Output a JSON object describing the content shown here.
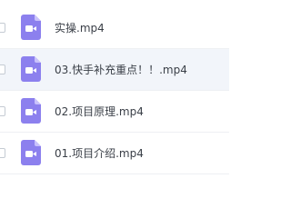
{
  "files": [
    {
      "name": "实操.mp4",
      "icon": "video-file-icon",
      "selected": false
    },
    {
      "name": "03.快手补充重点！！.mp4",
      "icon": "video-file-icon",
      "selected": true
    },
    {
      "name": "02.项目原理.mp4",
      "icon": "video-file-icon",
      "selected": false
    },
    {
      "name": "01.项目介绍.mp4",
      "icon": "video-file-icon",
      "selected": false
    }
  ],
  "colors": {
    "icon_purple": "#8c80ee",
    "icon_fold": "#c9c2fb",
    "text": "#3a3f47",
    "selected_row": "#f2f5fa",
    "divider": "#eef0f3"
  }
}
